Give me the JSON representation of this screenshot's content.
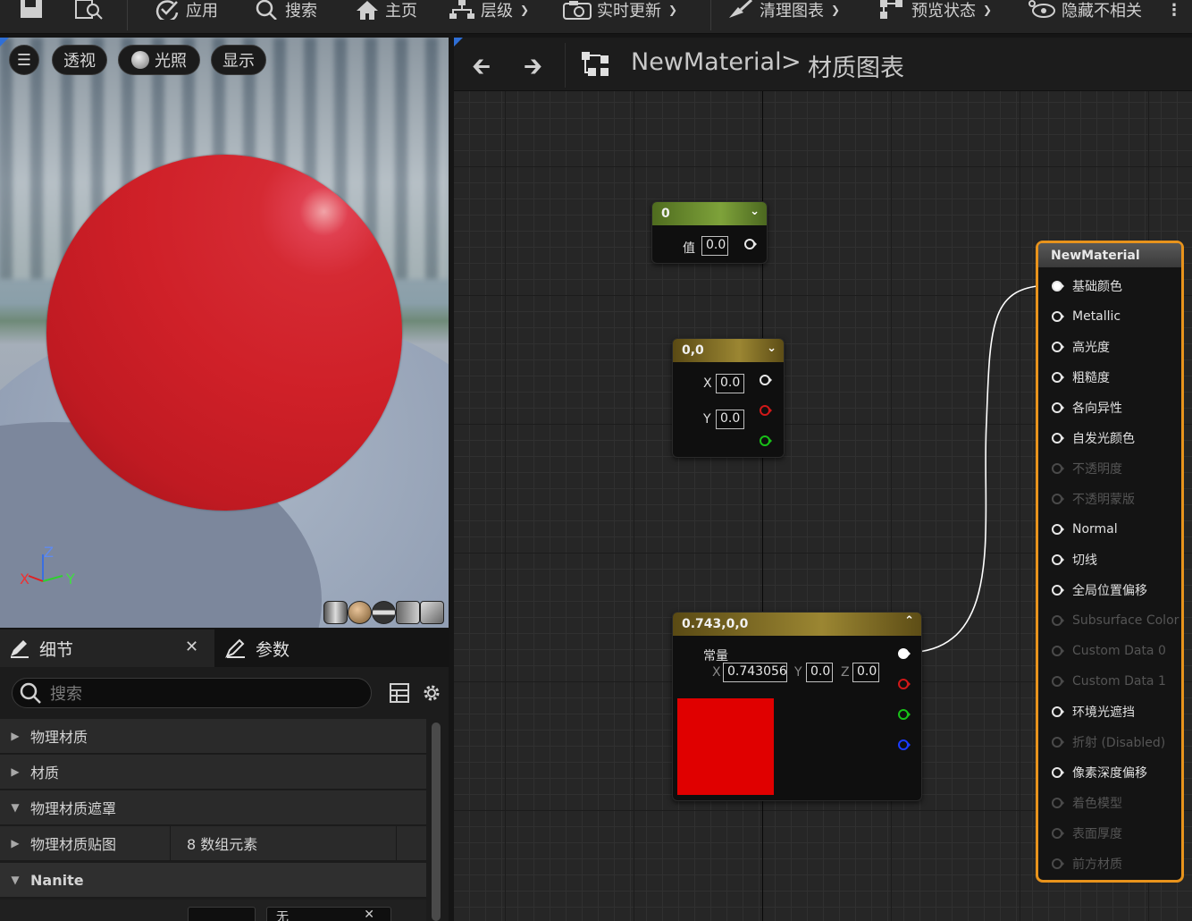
{
  "toolbar": {
    "apply_label": "应用",
    "search_label": "搜索",
    "home_label": "主页",
    "hierarchy_label": "层级",
    "live_update_label": "实时更新",
    "clean_graph_label": "清理图表",
    "preview_state_label": "预览状态",
    "hide_unrelated_label": "隐藏不相关"
  },
  "viewport": {
    "perspective_label": "透视",
    "lighting_label": "光照",
    "show_label": "显示",
    "axis_z": "Z",
    "axis_x": "X",
    "axis_y": "Y"
  },
  "details": {
    "tab_details": "细节",
    "tab_params": "参数",
    "search_placeholder": "搜索",
    "rows": [
      {
        "label": "物理材质",
        "value": "",
        "expanded": false
      },
      {
        "label": "材质",
        "value": "",
        "expanded": false
      },
      {
        "label": "物理材质遮罩",
        "value": "",
        "expanded": true
      },
      {
        "label": "物理材质贴图",
        "value": "8 数组元素",
        "expanded": false
      },
      {
        "label": "Nanite",
        "value": "",
        "expanded": true
      }
    ],
    "partial_dropdown": "无"
  },
  "graph": {
    "breadcrumb_asset": "NewMaterial",
    "breadcrumb_sep": ">",
    "breadcrumb_graph": "材质图表",
    "nodes": {
      "scalar": {
        "title": "0",
        "value_label": "值",
        "value": "0.0"
      },
      "vector2": {
        "title": "0,0",
        "x_label": "X",
        "x_value": "0.0",
        "y_label": "Y",
        "y_value": "0.0"
      },
      "vector3": {
        "title": "0.743,0,0",
        "const_label": "常量",
        "x_label": "X",
        "x_value": "0.743056",
        "y_label": "Y",
        "y_value": "0.0",
        "z_label": "Z",
        "z_value": "0.0",
        "swatch_color": "#e00000"
      }
    },
    "material_node": {
      "title": "NewMaterial",
      "pins": [
        {
          "label": "基础颜色",
          "active": true,
          "connected": true
        },
        {
          "label": "Metallic",
          "active": true
        },
        {
          "label": "高光度",
          "active": true
        },
        {
          "label": "粗糙度",
          "active": true
        },
        {
          "label": "各向异性",
          "active": true
        },
        {
          "label": "自发光颜色",
          "active": true
        },
        {
          "label": "不透明度",
          "active": false
        },
        {
          "label": "不透明蒙版",
          "active": false
        },
        {
          "label": "Normal",
          "active": true
        },
        {
          "label": "切线",
          "active": true
        },
        {
          "label": "全局位置偏移",
          "active": true
        },
        {
          "label": "Subsurface Color",
          "active": false
        },
        {
          "label": "Custom Data 0",
          "active": false
        },
        {
          "label": "Custom Data 1",
          "active": false
        },
        {
          "label": "环境光遮挡",
          "active": true
        },
        {
          "label": "折射 (Disabled)",
          "active": false
        },
        {
          "label": "像素深度偏移",
          "active": true
        },
        {
          "label": "着色模型",
          "active": false
        },
        {
          "label": "表面厚度",
          "active": false
        },
        {
          "label": "前方材质",
          "active": false
        }
      ]
    },
    "accent_color": "#e8931c"
  }
}
